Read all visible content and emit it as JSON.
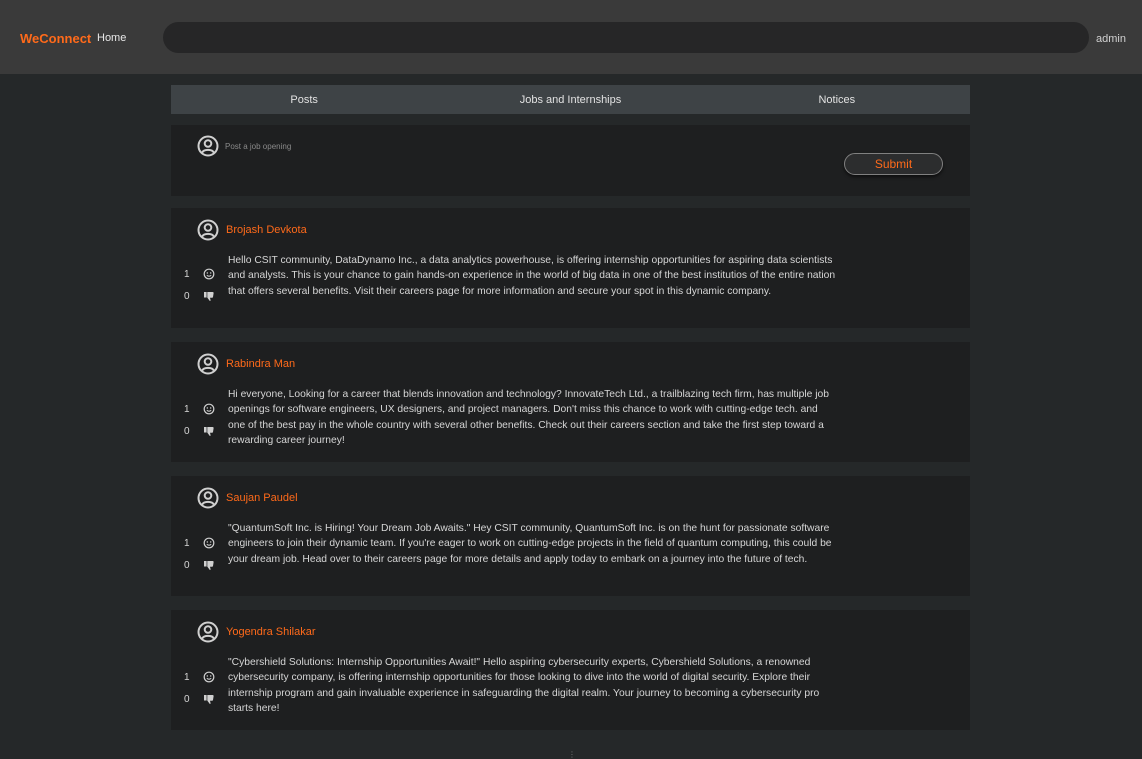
{
  "header": {
    "brand": "WeConnect",
    "home_label": "Home",
    "search_value": "",
    "user_label": "admin"
  },
  "tabs": [
    {
      "label": "Posts"
    },
    {
      "label": "Jobs and Internships"
    },
    {
      "label": "Notices"
    }
  ],
  "composer": {
    "placeholder": "Post a job opening",
    "submit_label": "Submit"
  },
  "posts": [
    {
      "author": "Brojash Devkota",
      "text": "Hello CSIT community, DataDynamo Inc., a data analytics powerhouse, is offering internship opportunities for aspiring data scientists and analysts. This is your chance to gain hands-on experience in the world of big data in one of the best institutios of the entire nation that offers several benefits. Visit their careers page for more information and secure your spot in this dynamic company.",
      "likes": "1",
      "dislikes": "0"
    },
    {
      "author": "Rabindra Man",
      "text": "Hi everyone, Looking for a career that blends innovation and technology? InnovateTech Ltd., a trailblazing tech firm, has multiple job openings for software engineers, UX designers, and project managers. Don't miss this chance to work with cutting-edge tech. and one of the best pay in the whole country with several other benefits. Check out their careers section and take the first step toward a rewarding career journey!",
      "likes": "1",
      "dislikes": "0"
    },
    {
      "author": "Saujan Paudel",
      "text": "\"QuantumSoft Inc. is Hiring! Your Dream Job Awaits.\" Hey CSIT community, QuantumSoft Inc. is on the hunt for passionate software engineers to join their dynamic team. If you're eager to work on cutting-edge projects in the field of quantum computing, this could be your dream job. Head over to their careers page for more details and apply today to embark on a journey into the future of tech.",
      "likes": "1",
      "dislikes": "0"
    },
    {
      "author": "Yogendra Shilakar",
      "text": "\"Cybershield Solutions: Internship Opportunities Await!\" Hello aspiring cybersecurity experts, Cybershield Solutions, a renowned cybersecurity company, is offering internship opportunities for those looking to dive into the world of digital security. Explore their internship program and gain invaluable experience in safeguarding the digital realm. Your journey to becoming a cybersecurity pro starts here!",
      "likes": "1",
      "dislikes": "0"
    }
  ],
  "colors": {
    "accent": "#ff6a1a",
    "background": "#252829",
    "card": "#1e1f20",
    "topbar": "#3a3a3a",
    "tabbar": "#3e4346"
  },
  "icons": {
    "avatar": "user-circle-icon",
    "like": "smiley-icon",
    "dislike": "thumbs-down-icon"
  }
}
